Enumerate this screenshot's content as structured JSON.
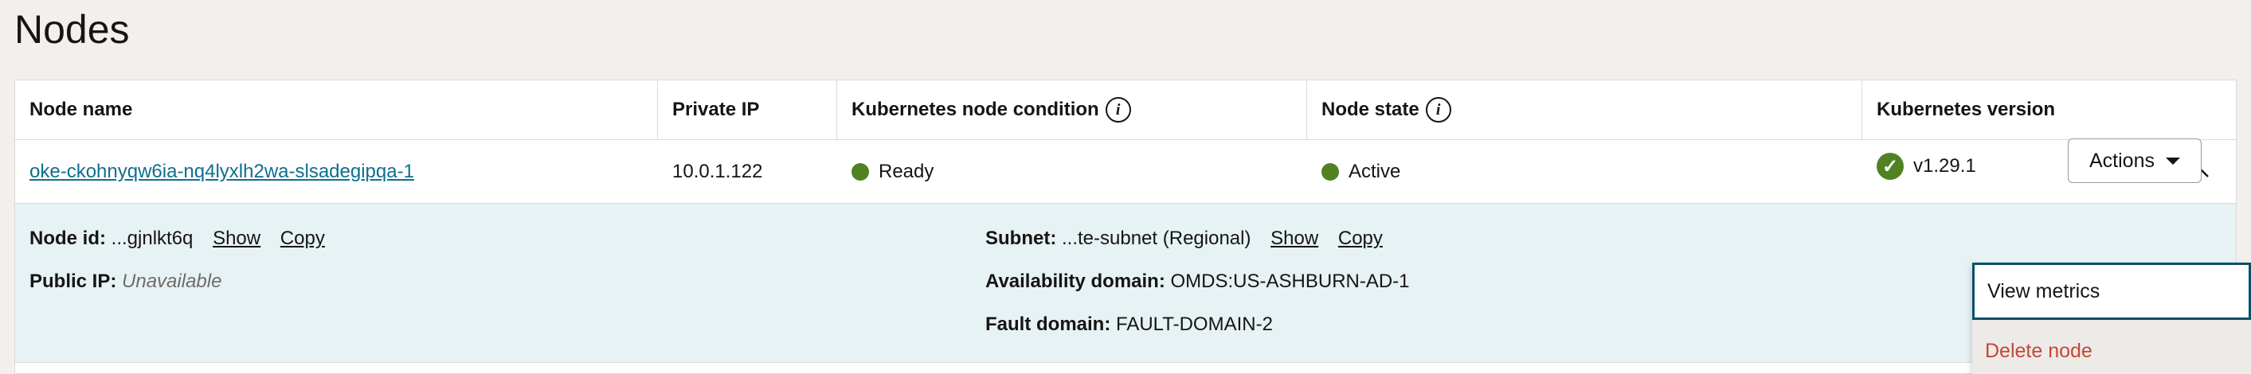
{
  "page": {
    "title": "Nodes"
  },
  "table": {
    "columns": [
      {
        "label": "Node name",
        "info": false
      },
      {
        "label": "Private IP",
        "info": false
      },
      {
        "label": "Kubernetes node condition",
        "info": true
      },
      {
        "label": "Node state",
        "info": true
      },
      {
        "label": "Kubernetes version",
        "info": false
      }
    ],
    "row": {
      "node_name": "oke-ckohnyqw6ia-nq4lyxlh2wa-slsadegipqa-1",
      "private_ip": "10.0.1.122",
      "condition": "Ready",
      "state": "Active",
      "version": "v1.29.1"
    }
  },
  "details": {
    "node_id_label": "Node id:",
    "node_id_value": "...gjnlkt6q",
    "show_label": "Show",
    "copy_label": "Copy",
    "public_ip_label": "Public IP:",
    "public_ip_value": "Unavailable",
    "subnet_label": "Subnet:",
    "subnet_value": "...te-subnet (Regional)",
    "availability_domain_label": "Availability domain:",
    "availability_domain_value": "OMDS:US-ASHBURN-AD-1",
    "fault_domain_label": "Fault domain:",
    "fault_domain_value": "FAULT-DOMAIN-2"
  },
  "actions": {
    "button_label": "Actions",
    "menu": {
      "view_metrics": "View metrics",
      "delete_node": "Delete node"
    }
  },
  "icons": {
    "info": "info-icon",
    "status_dot": "status-dot-icon",
    "check": "check-circle-icon",
    "chevron_up": "chevron-up-icon",
    "caret_down": "caret-down-icon"
  },
  "colors": {
    "link": "#0e6f8f",
    "success": "#508223",
    "details_bg": "#e7f2f5",
    "danger": "#c74634",
    "focus": "#0a4f68"
  }
}
